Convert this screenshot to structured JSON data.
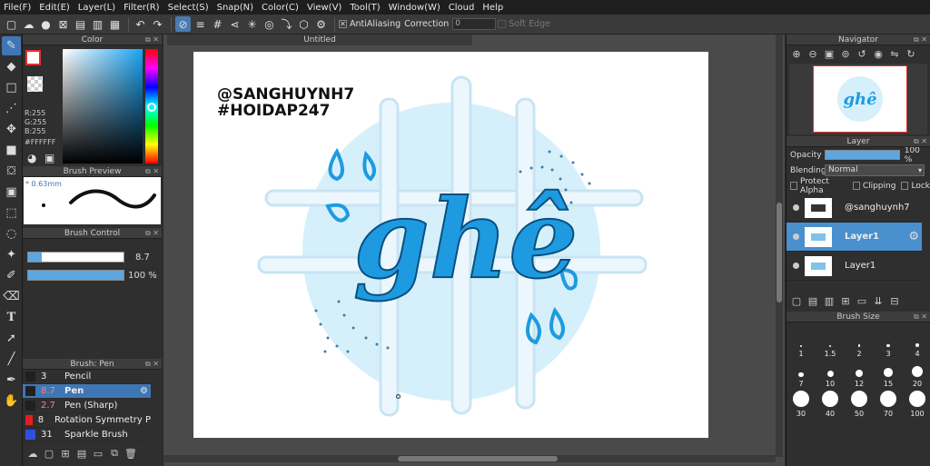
{
  "menu": [
    "File(F)",
    "Edit(E)",
    "Layer(L)",
    "Filter(R)",
    "Select(S)",
    "Snap(N)",
    "Color(C)",
    "View(V)",
    "Tool(T)",
    "Window(W)",
    "Cloud",
    "Help"
  ],
  "toolbar": {
    "antialiasing_label": "AntiAliasing",
    "correction_label": "Correction",
    "correction_value": "0",
    "soft_edge_label": "Soft Edge"
  },
  "color_panel": {
    "title": "Color",
    "r": "R:255",
    "g": "G:255",
    "b": "B:255",
    "hex": "#FFFFFF",
    "fg_color": "#ffffff",
    "accent": "#3f77b4"
  },
  "brush_preview": {
    "title": "Brush Preview",
    "size_label": "* 0.63mm"
  },
  "brush_control": {
    "title": "Brush Control",
    "size_value": "8.7",
    "opacity_value": "100 %",
    "size_fraction": 0.14,
    "opacity_fraction": 1.0
  },
  "brush_list": {
    "title": "Brush: Pen",
    "items": [
      {
        "size": "3",
        "name": "Pencil",
        "color": "#202020"
      },
      {
        "size": "8.7",
        "name": "Pen",
        "color": "#202020"
      },
      {
        "size": "2.7",
        "name": "Pen (Sharp)",
        "color": "#202020"
      },
      {
        "size": "8",
        "name": "Rotation Symmetry P",
        "color": "#e02020"
      },
      {
        "size": "31",
        "name": "Sparkle Brush",
        "color": "#3050e0"
      }
    ]
  },
  "document": {
    "tab_title": "Untitled"
  },
  "artwork": {
    "handle": "@SANGHUYNH7",
    "hashtag": "#HOIDAP247",
    "word": "ghê",
    "main_color": "#1e9be0",
    "light_color": "#d6f0fb"
  },
  "navigator": {
    "title": "Navigator"
  },
  "layer_panel": {
    "title": "Layer",
    "opacity_label": "Opacity",
    "opacity_value": "100 %",
    "opacity_fraction": 1.0,
    "blending_label": "Blending",
    "blending_value": "Normal",
    "protect_alpha": "Protect Alpha",
    "clipping": "Clipping",
    "lock": "Lock",
    "layers": [
      {
        "name": "@sanghuynh7"
      },
      {
        "name": "Layer1"
      },
      {
        "name": "Layer1"
      }
    ]
  },
  "brush_size": {
    "title": "Brush Size",
    "sizes": [
      "1",
      "1.5",
      "2",
      "3",
      "4",
      "7",
      "10",
      "12",
      "15",
      "20",
      "30",
      "40",
      "50",
      "70",
      "100"
    ]
  }
}
